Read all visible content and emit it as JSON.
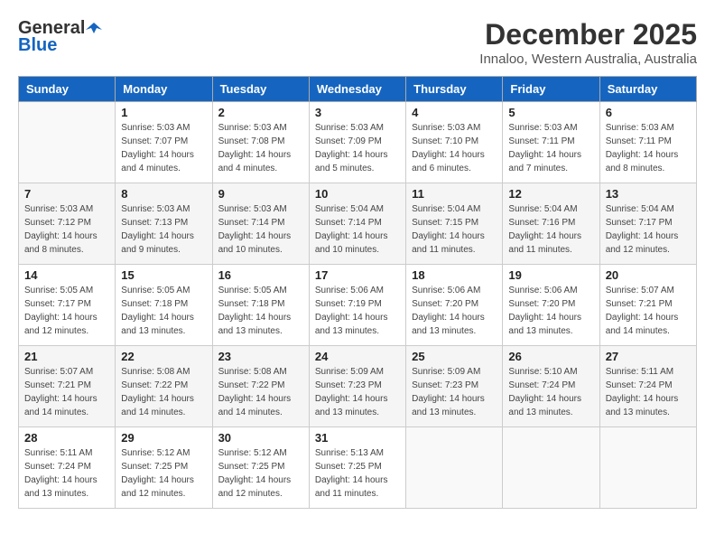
{
  "logo": {
    "general": "General",
    "blue": "Blue"
  },
  "title": "December 2025",
  "location": "Innaloo, Western Australia, Australia",
  "days_of_week": [
    "Sunday",
    "Monday",
    "Tuesday",
    "Wednesday",
    "Thursday",
    "Friday",
    "Saturday"
  ],
  "weeks": [
    [
      {
        "day": "",
        "info": ""
      },
      {
        "day": "1",
        "info": "Sunrise: 5:03 AM\nSunset: 7:07 PM\nDaylight: 14 hours\nand 4 minutes."
      },
      {
        "day": "2",
        "info": "Sunrise: 5:03 AM\nSunset: 7:08 PM\nDaylight: 14 hours\nand 4 minutes."
      },
      {
        "day": "3",
        "info": "Sunrise: 5:03 AM\nSunset: 7:09 PM\nDaylight: 14 hours\nand 5 minutes."
      },
      {
        "day": "4",
        "info": "Sunrise: 5:03 AM\nSunset: 7:10 PM\nDaylight: 14 hours\nand 6 minutes."
      },
      {
        "day": "5",
        "info": "Sunrise: 5:03 AM\nSunset: 7:11 PM\nDaylight: 14 hours\nand 7 minutes."
      },
      {
        "day": "6",
        "info": "Sunrise: 5:03 AM\nSunset: 7:11 PM\nDaylight: 14 hours\nand 8 minutes."
      }
    ],
    [
      {
        "day": "7",
        "info": "Sunrise: 5:03 AM\nSunset: 7:12 PM\nDaylight: 14 hours\nand 8 minutes."
      },
      {
        "day": "8",
        "info": "Sunrise: 5:03 AM\nSunset: 7:13 PM\nDaylight: 14 hours\nand 9 minutes."
      },
      {
        "day": "9",
        "info": "Sunrise: 5:03 AM\nSunset: 7:14 PM\nDaylight: 14 hours\nand 10 minutes."
      },
      {
        "day": "10",
        "info": "Sunrise: 5:04 AM\nSunset: 7:14 PM\nDaylight: 14 hours\nand 10 minutes."
      },
      {
        "day": "11",
        "info": "Sunrise: 5:04 AM\nSunset: 7:15 PM\nDaylight: 14 hours\nand 11 minutes."
      },
      {
        "day": "12",
        "info": "Sunrise: 5:04 AM\nSunset: 7:16 PM\nDaylight: 14 hours\nand 11 minutes."
      },
      {
        "day": "13",
        "info": "Sunrise: 5:04 AM\nSunset: 7:17 PM\nDaylight: 14 hours\nand 12 minutes."
      }
    ],
    [
      {
        "day": "14",
        "info": "Sunrise: 5:05 AM\nSunset: 7:17 PM\nDaylight: 14 hours\nand 12 minutes."
      },
      {
        "day": "15",
        "info": "Sunrise: 5:05 AM\nSunset: 7:18 PM\nDaylight: 14 hours\nand 13 minutes."
      },
      {
        "day": "16",
        "info": "Sunrise: 5:05 AM\nSunset: 7:18 PM\nDaylight: 14 hours\nand 13 minutes."
      },
      {
        "day": "17",
        "info": "Sunrise: 5:06 AM\nSunset: 7:19 PM\nDaylight: 14 hours\nand 13 minutes."
      },
      {
        "day": "18",
        "info": "Sunrise: 5:06 AM\nSunset: 7:20 PM\nDaylight: 14 hours\nand 13 minutes."
      },
      {
        "day": "19",
        "info": "Sunrise: 5:06 AM\nSunset: 7:20 PM\nDaylight: 14 hours\nand 13 minutes."
      },
      {
        "day": "20",
        "info": "Sunrise: 5:07 AM\nSunset: 7:21 PM\nDaylight: 14 hours\nand 14 minutes."
      }
    ],
    [
      {
        "day": "21",
        "info": "Sunrise: 5:07 AM\nSunset: 7:21 PM\nDaylight: 14 hours\nand 14 minutes."
      },
      {
        "day": "22",
        "info": "Sunrise: 5:08 AM\nSunset: 7:22 PM\nDaylight: 14 hours\nand 14 minutes."
      },
      {
        "day": "23",
        "info": "Sunrise: 5:08 AM\nSunset: 7:22 PM\nDaylight: 14 hours\nand 14 minutes."
      },
      {
        "day": "24",
        "info": "Sunrise: 5:09 AM\nSunset: 7:23 PM\nDaylight: 14 hours\nand 13 minutes."
      },
      {
        "day": "25",
        "info": "Sunrise: 5:09 AM\nSunset: 7:23 PM\nDaylight: 14 hours\nand 13 minutes."
      },
      {
        "day": "26",
        "info": "Sunrise: 5:10 AM\nSunset: 7:24 PM\nDaylight: 14 hours\nand 13 minutes."
      },
      {
        "day": "27",
        "info": "Sunrise: 5:11 AM\nSunset: 7:24 PM\nDaylight: 14 hours\nand 13 minutes."
      }
    ],
    [
      {
        "day": "28",
        "info": "Sunrise: 5:11 AM\nSunset: 7:24 PM\nDaylight: 14 hours\nand 13 minutes."
      },
      {
        "day": "29",
        "info": "Sunrise: 5:12 AM\nSunset: 7:25 PM\nDaylight: 14 hours\nand 12 minutes."
      },
      {
        "day": "30",
        "info": "Sunrise: 5:12 AM\nSunset: 7:25 PM\nDaylight: 14 hours\nand 12 minutes."
      },
      {
        "day": "31",
        "info": "Sunrise: 5:13 AM\nSunset: 7:25 PM\nDaylight: 14 hours\nand 11 minutes."
      },
      {
        "day": "",
        "info": ""
      },
      {
        "day": "",
        "info": ""
      },
      {
        "day": "",
        "info": ""
      }
    ]
  ]
}
